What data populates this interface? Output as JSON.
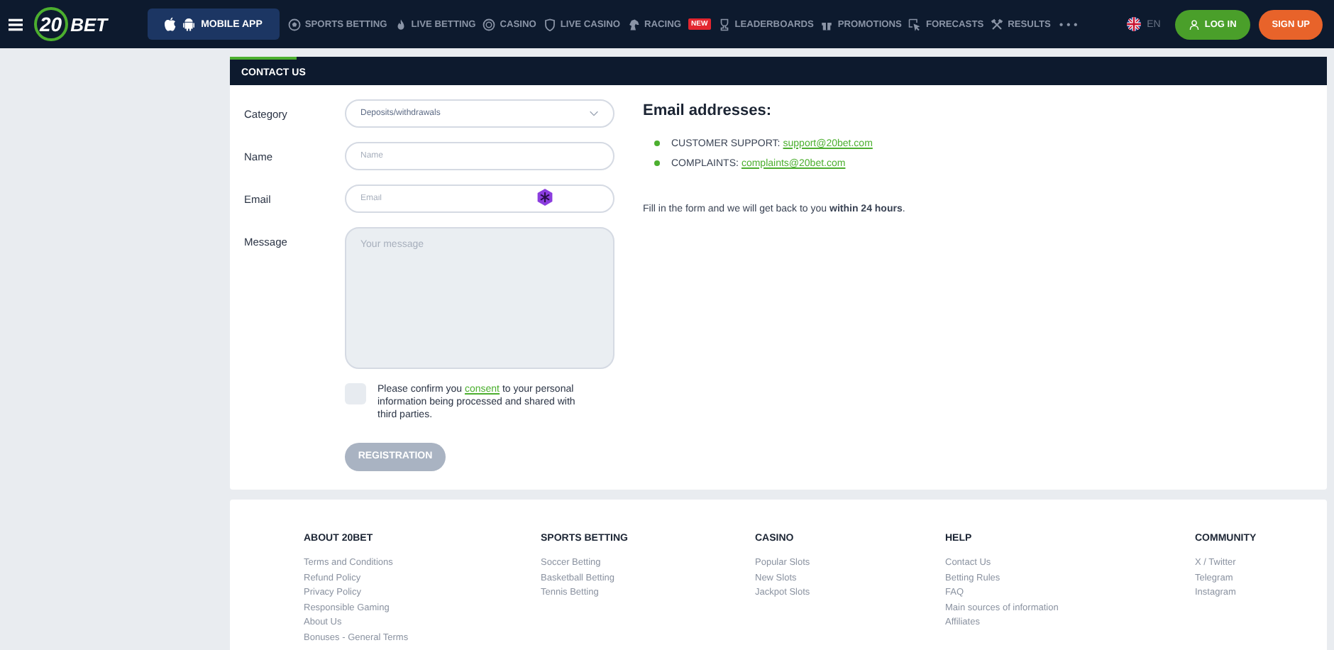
{
  "header": {
    "logo": {
      "number": "20",
      "word": "BET"
    },
    "mobile_app": "MOBILE APP",
    "nav": [
      {
        "label": "SPORTS BETTING"
      },
      {
        "label": "LIVE BETTING"
      },
      {
        "label": "CASINO"
      },
      {
        "label": "LIVE CASINO"
      },
      {
        "label": "RACING",
        "badge": "NEW"
      },
      {
        "label": "LEADERBOARDS"
      },
      {
        "label": "PROMOTIONS"
      },
      {
        "label": "FORECASTS"
      },
      {
        "label": "RESULTS"
      }
    ],
    "more": "• • •",
    "language": "EN",
    "login": "LOG IN",
    "signup": "SIGN UP"
  },
  "contact": {
    "title": "CONTACT US",
    "fields": [
      {
        "kind": "select",
        "label": "Category",
        "value": "Deposits/withdrawals"
      },
      {
        "kind": "input",
        "label": "Name",
        "placeholder": "Name"
      },
      {
        "kind": "input",
        "label": "Email",
        "placeholder": "Email",
        "extension_icon": true
      },
      {
        "kind": "textarea",
        "label": "Message",
        "placeholder": "Your message"
      }
    ],
    "consent": {
      "checked": false,
      "before": "Please confirm you ",
      "link": "consent",
      "after": " to your personal information being processed and shared with third parties."
    },
    "submit": {
      "label": "REGISTRATION",
      "disabled": true
    },
    "emails_title": "Email addresses:",
    "emails": [
      {
        "label": "CUSTOMER SUPPORT:",
        "email": "support@20bet.com"
      },
      {
        "label": "COMPLAINTS:",
        "email": "complaints@20bet.com"
      }
    ],
    "note": "Fill in the form and we will get back to you **within 24 hours**."
  },
  "footer": [
    {
      "title": "ABOUT 20BET",
      "links": [
        "Terms and Conditions",
        "Refund Policy",
        "Privacy Policy",
        "Responsible Gaming",
        "About Us",
        "Bonuses - General Terms"
      ]
    },
    {
      "title": "SPORTS BETTING",
      "links": [
        "Soccer Betting",
        "Basketball Betting",
        "Tennis Betting"
      ]
    },
    {
      "title": "CASINO",
      "links": [
        "Popular Slots",
        "New Slots",
        "Jackpot Slots"
      ]
    },
    {
      "title": "HELP",
      "links": [
        "Contact Us",
        "Betting Rules",
        "FAQ",
        "Main sources of information",
        "Affiliates"
      ]
    },
    {
      "title": "COMMUNITY",
      "links": [
        "X / Twitter",
        "Telegram",
        "Instagram"
      ]
    }
  ]
}
